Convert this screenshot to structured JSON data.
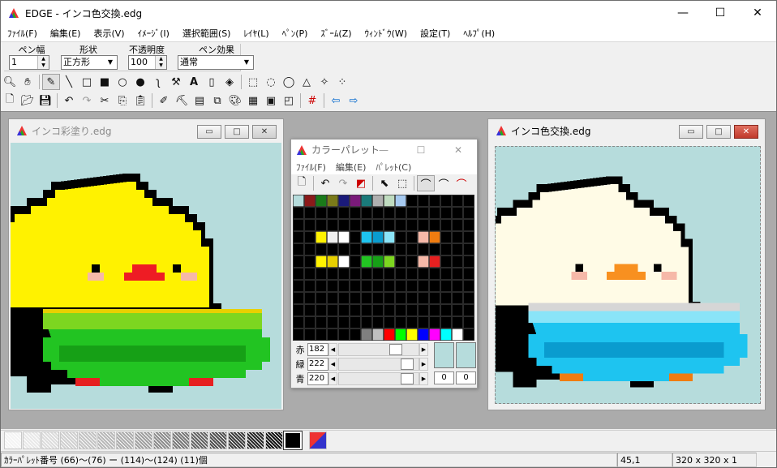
{
  "app": {
    "title": "EDGE - インコ色交換.edg"
  },
  "window_controls": {
    "minimize": "—",
    "maximize": "☐",
    "close": "✕"
  },
  "menu": [
    "ﾌｧｲﾙ(F)",
    "編集(E)",
    "表示(V)",
    "ｲﾒｰｼﾞ(I)",
    "選択範囲(S)",
    "ﾚｲﾔ(L)",
    "ﾍﾟﾝ(P)",
    "ｽﾞｰﾑ(Z)",
    "ｳｨﾝﾄﾞｳ(W)",
    "設定(T)",
    "ﾍﾙﾌﾟ(H)"
  ],
  "options": {
    "pen_width_label": "ペン幅",
    "pen_width_value": "1",
    "shape_label": "形状",
    "shape_value": "正方形",
    "opacity_label": "不透明度",
    "opacity_value": "100",
    "effect_label": "ペン効果",
    "effect_value": "通常"
  },
  "toolbar1_icons": [
    "zoom-icon",
    "hand-icon",
    "pen-icon",
    "line-icon",
    "rect-icon",
    "filled-rect-icon",
    "ellipse-icon",
    "filled-ellipse-icon",
    "curve-icon",
    "fill-icon",
    "text-icon",
    "eraser-icon",
    "replace-icon",
    "rect-select-icon",
    "ellipse-select-icon",
    "lasso-select-icon",
    "polygon-select-icon",
    "magic-select-icon",
    "pattern-select-icon"
  ],
  "toolbar2_icons": [
    "new-icon",
    "open-icon",
    "save-icon",
    "undo-icon",
    "redo-icon",
    "cut-icon",
    "copy-icon",
    "paste-icon",
    "edit-palette-icon",
    "transform-icon",
    "layer-icon",
    "copy-layer-icon",
    "palette-icon",
    "film-icon",
    "preview-icon",
    "frame-icon",
    "grid-icon",
    "prev-icon",
    "next-icon"
  ],
  "left_window": {
    "title": "インコ彩塗り.edg"
  },
  "right_window": {
    "title": "インコ色交換.edg"
  },
  "palette_window": {
    "title": "カラーパレット",
    "menu": [
      "ﾌｧｲﾙ(F)",
      "編集(E)",
      "ﾊﾟﾚｯﾄ(C)"
    ],
    "sliders": [
      {
        "label": "赤",
        "value": "182"
      },
      {
        "label": "緑",
        "value": "222"
      },
      {
        "label": "青",
        "value": "220"
      }
    ],
    "index_left": "0",
    "index_right": "0"
  },
  "status": {
    "info": "ｶﾗｰﾊﾟﾚｯﾄ番号 (66)〜(76) ー (114)〜(124) (11)個",
    "coords": "45,1",
    "size": "320 x 320 x 1"
  },
  "colors": {
    "canvas_bg": "#b6dcdc",
    "mdi_bg": "#ababab",
    "yellow": "#fff200",
    "cream": "#fffbe6",
    "green": "#22c422",
    "cyan": "#1ec4f0"
  }
}
